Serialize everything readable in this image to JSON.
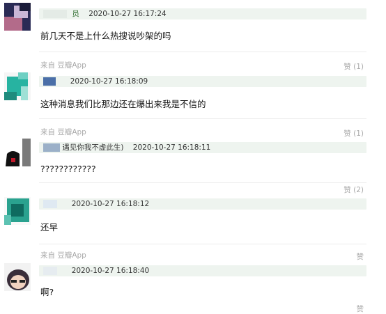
{
  "comments": [
    {
      "meta": "",
      "like": "",
      "username": "员",
      "time": "2020-10-27 16:17:24",
      "text": "前几天不是上什么热搜说吵架的吗"
    },
    {
      "meta": "来自 豆瓣App",
      "like": "赞 (1)",
      "username": "",
      "time": "2020-10-27 16:18:09",
      "text": "这种消息我们比那边还在爆出来我是不信的"
    },
    {
      "meta": "来自 豆瓣App",
      "like": "赞 (1)",
      "username": "遇见你我不虚此生)",
      "time": "2020-10-27 16:18:11",
      "text": "????????????"
    },
    {
      "meta": "",
      "like": "赞 (2)",
      "username": "",
      "time": "2020-10-27 16:18:12",
      "text": "还早"
    },
    {
      "meta": "来自 豆瓣App",
      "like": "赞",
      "username": "",
      "time": "2020-10-27 16:18:40",
      "text": "啊?"
    }
  ],
  "footer_like": "赞",
  "colors": {
    "header_bg": "#eef4ef",
    "username": "#2c6b2c",
    "meta": "#aaaaaa",
    "separator": "#ececec"
  }
}
